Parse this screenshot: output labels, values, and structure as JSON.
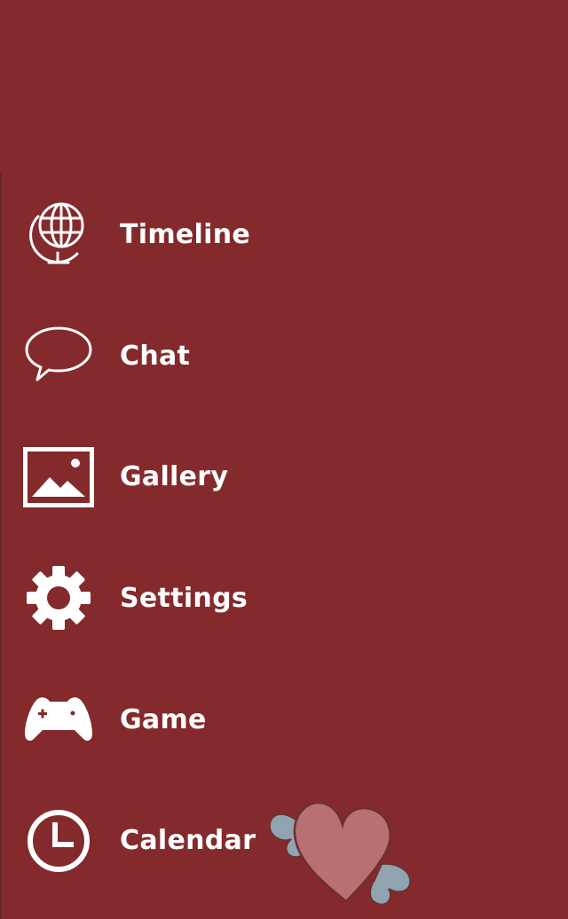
{
  "colors": {
    "background": "#842a2c",
    "header": "#822a2e",
    "text": "#ffffff",
    "heart": "#b87070",
    "wing": "#8fa4b0"
  },
  "menu": {
    "items": [
      {
        "label": "Timeline",
        "icon": "globe-icon"
      },
      {
        "label": "Chat",
        "icon": "speech-bubble-icon"
      },
      {
        "label": "Gallery",
        "icon": "image-icon"
      },
      {
        "label": "Settings",
        "icon": "gear-icon"
      },
      {
        "label": "Game",
        "icon": "gamepad-icon"
      },
      {
        "label": "Calendar",
        "icon": "clock-icon"
      }
    ]
  },
  "decoration": {
    "icon": "winged-heart-sticker"
  }
}
